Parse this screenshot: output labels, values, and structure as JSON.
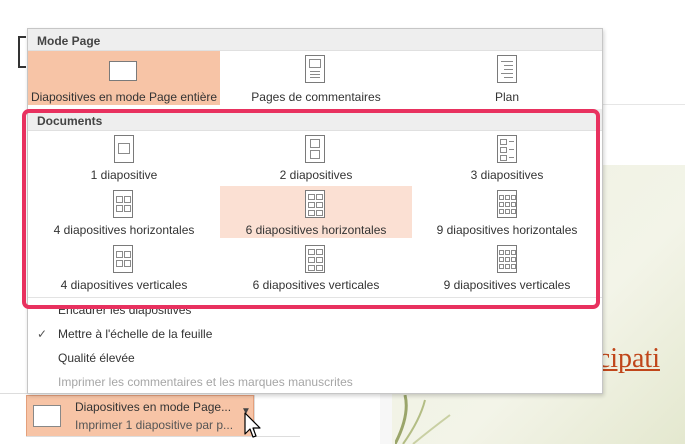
{
  "background": {
    "word_fragment": "icipati"
  },
  "menu": {
    "mode_page": {
      "header": "Mode Page",
      "items": [
        {
          "label": "Diapositives en mode Page entière",
          "icon": "full-page-slide-icon"
        },
        {
          "label": "Pages de commentaires",
          "icon": "notes-page-icon"
        },
        {
          "label": "Plan",
          "icon": "outline-icon"
        }
      ]
    },
    "documents": {
      "header": "Documents",
      "items": [
        {
          "label": "1 diapositive",
          "icon": "handout-1-icon"
        },
        {
          "label": "2 diapositives",
          "icon": "handout-2-icon"
        },
        {
          "label": "3 diapositives",
          "icon": "handout-3-icon"
        },
        {
          "label": "4 diapositives horizontales",
          "icon": "handout-4-horizontal-icon"
        },
        {
          "label": "6 diapositives horizontales",
          "icon": "handout-6-horizontal-icon"
        },
        {
          "label": "9 diapositives horizontales",
          "icon": "handout-9-horizontal-icon"
        },
        {
          "label": "4 diapositives verticales",
          "icon": "handout-4-vertical-icon"
        },
        {
          "label": "6 diapositives verticales",
          "icon": "handout-6-vertical-icon"
        },
        {
          "label": "9 diapositives verticales",
          "icon": "handout-9-vertical-icon"
        }
      ]
    },
    "options": [
      {
        "label": "Encadrer les diapositives",
        "checked": false,
        "enabled": true
      },
      {
        "label": "Mettre à l'échelle de la feuille",
        "checked": true,
        "enabled": true
      },
      {
        "label": "Qualité élevée",
        "checked": false,
        "enabled": true
      },
      {
        "label": "Imprimer les commentaires et les marques manuscrites",
        "checked": false,
        "enabled": false
      }
    ],
    "check_glyph": "✓"
  },
  "print_option": {
    "title": "Diapositives en mode Page...",
    "subtitle": "Imprimer 1 diapositive par p...",
    "chevron": "▼"
  },
  "colors": {
    "selected_strong": "#f7c4a6",
    "selected_soft": "#fbe0d3",
    "highlight_border": "#e8315f"
  }
}
